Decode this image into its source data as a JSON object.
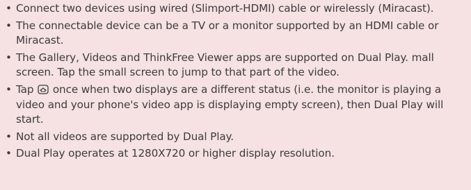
{
  "document": {
    "bullet_symbol": "•",
    "items": [
      {
        "text": "Connect two devices using wired (Slimport-HDMI) cable or wirelessly (Miracast)."
      },
      {
        "text": "The connectable device can be a TV or a monitor supported by an HDMI cable or Miracast."
      },
      {
        "text": "The Gallery, Videos and ThinkFree Viewer apps are supported on Dual Play. mall screen. Tap the small screen to jump to that part of the video."
      },
      {
        "text_before": "Tap ",
        "icon": "home-key-icon",
        "text_after": " once when two displays are a different status (i.e. the monitor is playing a video and your phone's video app is displaying empty screen), then Dual Play will start."
      },
      {
        "text": "Not all videos are supported by Dual Play."
      },
      {
        "text": "Dual Play operates at 1280X720 or higher display resolution."
      }
    ]
  }
}
